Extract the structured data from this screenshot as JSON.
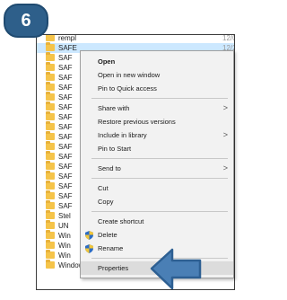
{
  "step_badge": {
    "number": "6"
  },
  "file_list": {
    "rows": [
      {
        "name": "rempl",
        "date": "12/0",
        "selected": false
      },
      {
        "name": "SAFE",
        "date": "12/2",
        "selected": true
      },
      {
        "name": "SAF",
        "date": "",
        "selected": false
      },
      {
        "name": "SAF",
        "date": "",
        "selected": false
      },
      {
        "name": "SAF",
        "date": "",
        "selected": false
      },
      {
        "name": "SAF",
        "date": "",
        "selected": false
      },
      {
        "name": "SAF",
        "date": "",
        "selected": false
      },
      {
        "name": "SAF",
        "date": "",
        "selected": false
      },
      {
        "name": "SAF",
        "date": "",
        "selected": false
      },
      {
        "name": "SAF",
        "date": "",
        "selected": false
      },
      {
        "name": "SAF",
        "date": "",
        "selected": false
      },
      {
        "name": "SAF",
        "date": "",
        "selected": false
      },
      {
        "name": "SAF",
        "date": "",
        "selected": false
      },
      {
        "name": "SAF",
        "date": "",
        "selected": false
      },
      {
        "name": "SAF",
        "date": "",
        "selected": false
      },
      {
        "name": "SAF",
        "date": "",
        "selected": false
      },
      {
        "name": "SAF",
        "date": "",
        "selected": false
      },
      {
        "name": "SAF",
        "date": "",
        "selected": false
      },
      {
        "name": "Stel",
        "date": "",
        "selected": false
      },
      {
        "name": "UN",
        "date": "",
        "selected": false
      },
      {
        "name": "Win",
        "date": "",
        "selected": false
      },
      {
        "name": "Win",
        "date": "",
        "selected": false
      },
      {
        "name": "Win",
        "date": "",
        "selected": false
      },
      {
        "name": "Windows Mail",
        "date": "10/",
        "selected": false
      }
    ]
  },
  "context_menu": {
    "items": [
      {
        "label": "Open",
        "bold": true
      },
      {
        "label": "Open in new window"
      },
      {
        "label": "Pin to Quick access"
      },
      {
        "separator": true
      },
      {
        "label": "Share with",
        "submenu": true
      },
      {
        "label": "Restore previous versions"
      },
      {
        "label": "Include in library",
        "submenu": true
      },
      {
        "label": "Pin to Start"
      },
      {
        "separator": true
      },
      {
        "label": "Send to",
        "submenu": true
      },
      {
        "separator": true
      },
      {
        "label": "Cut"
      },
      {
        "label": "Copy"
      },
      {
        "separator": true
      },
      {
        "label": "Create shortcut"
      },
      {
        "label": "Delete",
        "icon": "uac-shield-icon"
      },
      {
        "label": "Rename",
        "icon": "uac-shield-icon"
      },
      {
        "separator": true
      },
      {
        "label": "Properties",
        "highlighted": true
      }
    ],
    "submenu_arrow": ">"
  },
  "colors": {
    "badge": "#2e5f8a",
    "arrow": "#4a7fb5",
    "selected_row": "#cce8ff",
    "folder": "#f5c44a"
  }
}
